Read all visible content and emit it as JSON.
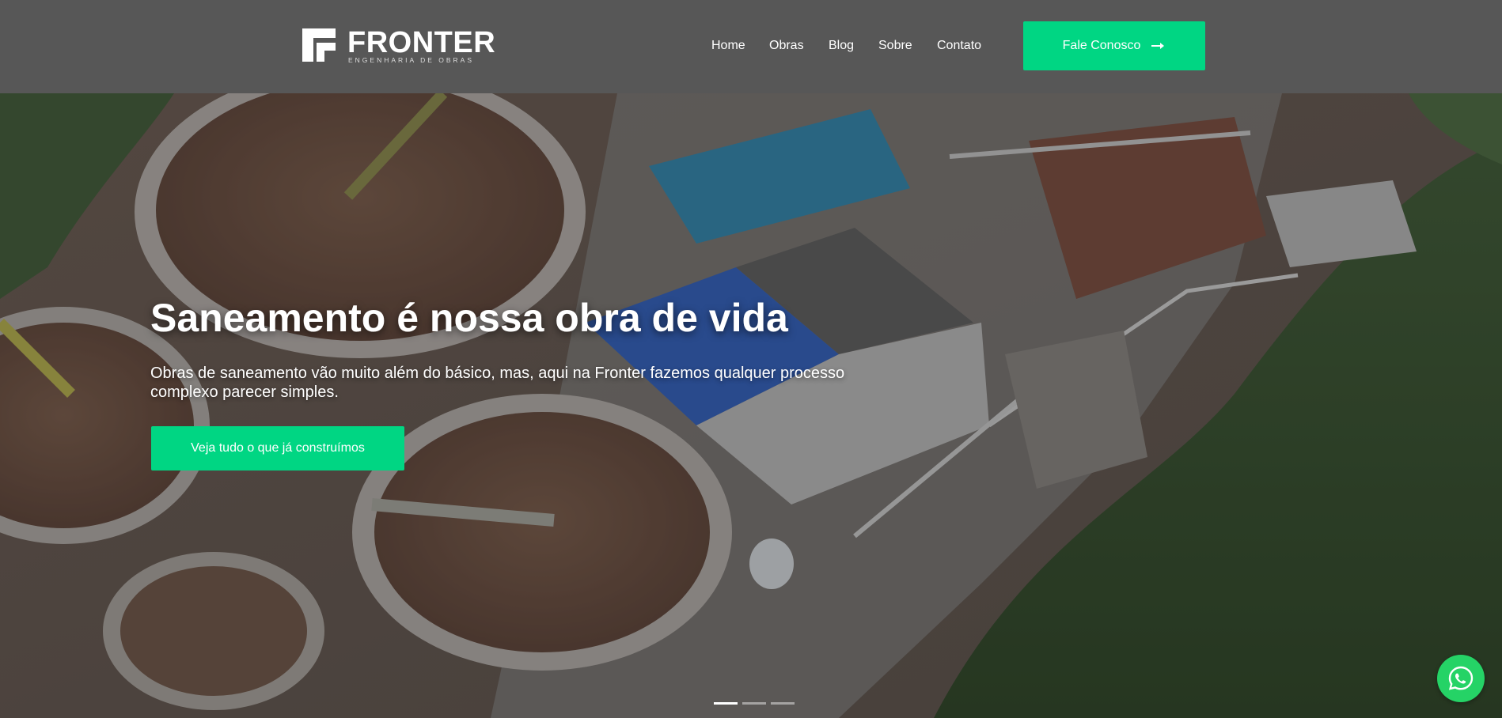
{
  "brand": {
    "name": "FRONTER",
    "tagline": "ENGENHARIA DE OBRAS"
  },
  "nav": {
    "items": [
      {
        "label": "Home"
      },
      {
        "label": "Obras"
      },
      {
        "label": "Blog"
      },
      {
        "label": "Sobre"
      },
      {
        "label": "Contato"
      }
    ]
  },
  "header": {
    "cta_label": "Fale Conosco",
    "cta_icon": "arrow-right-icon"
  },
  "hero": {
    "title": "Saneamento é nossa obra de vida",
    "subtitle": "Obras de saneamento vão muito além do básico, mas, aqui na Fronter fazemos qualquer processo complexo parecer simples.",
    "button_label": "Veja tudo o que já construímos",
    "slides_count": 3,
    "active_slide": 1
  },
  "floating": {
    "icon": "whatsapp-icon"
  },
  "colors": {
    "header_bg": "#575757",
    "accent": "#00d683",
    "whatsapp": "#25d366",
    "text": "#ffffff"
  }
}
